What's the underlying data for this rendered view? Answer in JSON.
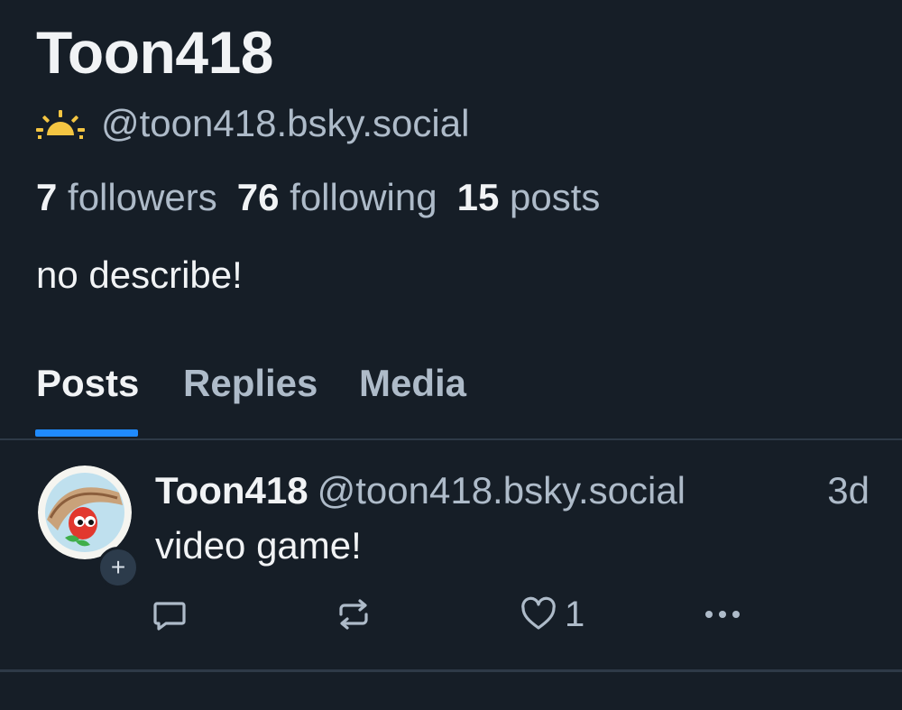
{
  "profile": {
    "display_name": "Toon418",
    "handle": "@toon418.bsky.social",
    "handle_icon": "sunrise-icon",
    "stats": {
      "followers_count": "7",
      "followers_label": "followers",
      "following_count": "76",
      "following_label": "following",
      "posts_count": "15",
      "posts_label": "posts"
    },
    "bio": "no describe!"
  },
  "tabs": [
    {
      "label": "Posts",
      "active": true
    },
    {
      "label": "Replies",
      "active": false
    },
    {
      "label": "Media",
      "active": false
    }
  ],
  "post": {
    "author": "Toon418",
    "handle": "@toon418.bsky.social",
    "time": "3d",
    "text": "video game!",
    "like_count": "1",
    "icons": {
      "reply": "reply-icon",
      "repost": "repost-icon",
      "like": "heart-icon",
      "more": "more-icon",
      "follow": "plus-icon"
    }
  },
  "colors": {
    "background": "#161e27",
    "text_primary": "#f1f3f5",
    "text_secondary": "#aebbc9",
    "accent": "#208bfe",
    "divider": "#2e3a47",
    "sun": "#f4c542"
  }
}
